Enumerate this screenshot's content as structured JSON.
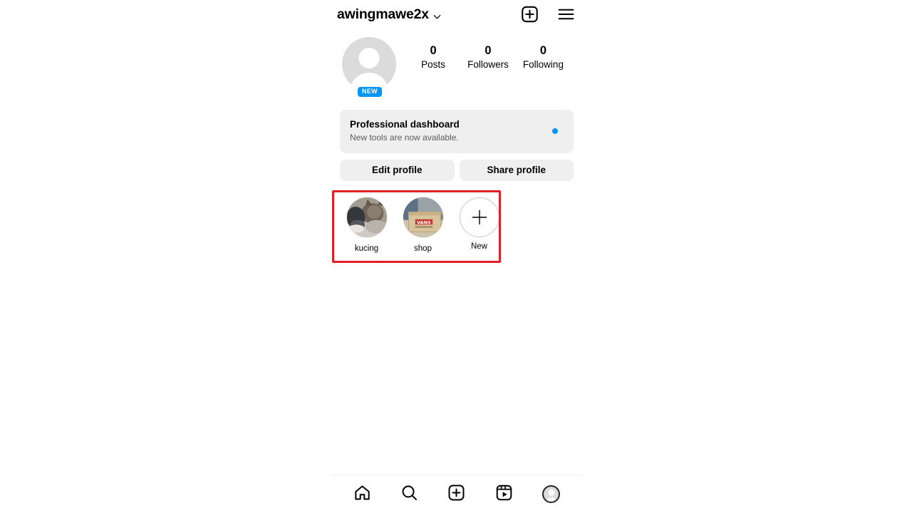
{
  "header": {
    "username": "awingmawe2x",
    "chevron_icon": "chevron-down-icon",
    "new_post_icon": "plus-square-icon",
    "menu_icon": "hamburger-menu-icon"
  },
  "profile": {
    "avatar_icon": "default-avatar-icon",
    "new_badge": "NEW",
    "stats": [
      {
        "value": "0",
        "label": "Posts"
      },
      {
        "value": "0",
        "label": "Followers"
      },
      {
        "value": "0",
        "label": "Following"
      }
    ]
  },
  "dashboard": {
    "title": "Professional dashboard",
    "subtitle": "New tools are now available.",
    "dot_color": "#0095f6"
  },
  "actions": {
    "edit_profile": "Edit profile",
    "share_profile": "Share profile"
  },
  "highlights": {
    "items": [
      {
        "label": "kucing",
        "thumb": "cat-photo"
      },
      {
        "label": "shop",
        "thumb": "vans-box-photo"
      },
      {
        "label": "New",
        "thumb": "plus-icon"
      }
    ],
    "annotation_color": "#e01f26"
  },
  "bottom_nav": {
    "items": [
      {
        "icon": "home-icon",
        "label": "Home"
      },
      {
        "icon": "search-icon",
        "label": "Search"
      },
      {
        "icon": "create-plus-icon",
        "label": "Create"
      },
      {
        "icon": "reels-icon",
        "label": "Reels"
      },
      {
        "icon": "profile-avatar-icon",
        "label": "Profile"
      }
    ],
    "active_index": 4
  }
}
